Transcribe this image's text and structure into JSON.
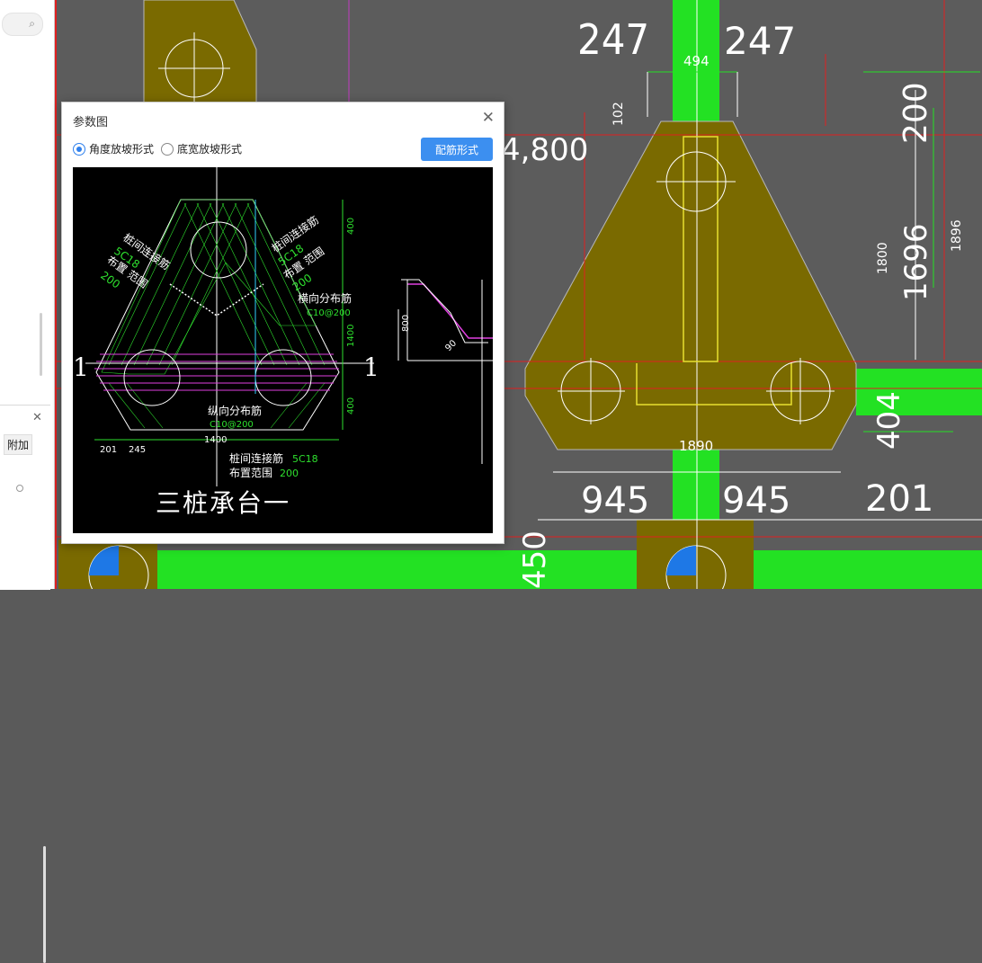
{
  "background_dims": {
    "d247_left": "247",
    "d247_right": "247",
    "d494": "494",
    "d102": "102",
    "d4800": "4,800",
    "d200": "200",
    "d1800": "1800",
    "d1696": "1696",
    "d1896": "1896",
    "d1890": "1890",
    "d945_left": "945",
    "d945_right": "945",
    "d201": "201",
    "d404": "404",
    "d450": "450"
  },
  "sidebar": {
    "addon_label": "附加"
  },
  "dialog": {
    "title": "参数图",
    "radio_angle": "角度放坡形式",
    "radio_width": "底宽放坡形式",
    "rebar_button": "配筋形式"
  },
  "drawing": {
    "title": "三桩承台一",
    "section_mark": "1",
    "pile_rebar_left": "桩间连接筋",
    "pile_rebar_left_spec": "5C18",
    "pile_rebar_left_range": "布置 范围",
    "pile_rebar_left_range_val": "200",
    "pile_rebar_right": "桩间连接筋",
    "pile_rebar_right_spec": "5C18",
    "pile_rebar_right_range": "布置 范围",
    "pile_rebar_right_range_val": "200",
    "trans_rebar": "横向分布筋",
    "trans_rebar_spec": "C10@200",
    "long_rebar": "纵向分布筋",
    "long_rebar_spec": "C10@200",
    "bottom_rebar": "桩间连接筋",
    "bottom_rebar_spec": "5C18",
    "bottom_range": "布置范围",
    "bottom_range_val": "200",
    "dim_400_top": "400",
    "dim_1400_mid": "1400",
    "dim_400_bot": "400",
    "dim_201": "201",
    "dim_245": "245",
    "dim_1400_bottom": "1400",
    "dim_800": "800",
    "dim_90": "90"
  }
}
